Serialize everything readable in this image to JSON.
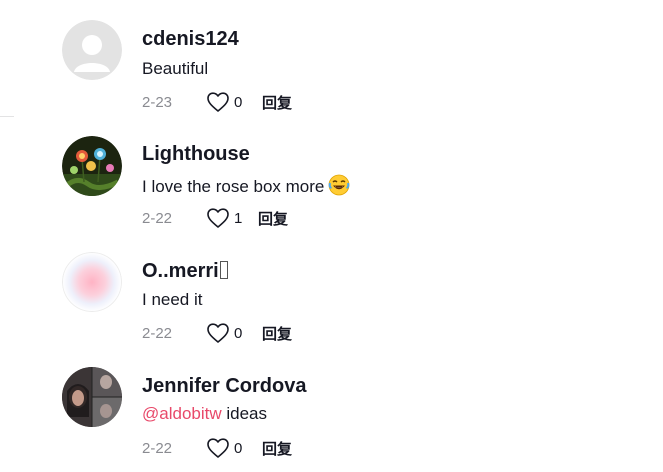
{
  "comments": [
    {
      "username": "cdenis124",
      "text": "Beautiful",
      "date": "2-23",
      "likes": "0",
      "reply_label": "回复",
      "avatar": "default-avatar-icon"
    },
    {
      "username": "Lighthouse",
      "text": "I love the rose box more",
      "emoji": "laughing-tears-emoji",
      "date": "2-22",
      "likes": "1",
      "reply_label": "回复",
      "avatar": "photo-garden-lights"
    },
    {
      "username": "O..merri",
      "text": "I need it",
      "date": "2-22",
      "likes": "0",
      "reply_label": "回复",
      "avatar": "pink-gradient-dot"
    },
    {
      "username": "Jennifer Cordova",
      "mention": "@aldobitw",
      "text": " ideas",
      "date": "2-22",
      "likes": "0",
      "reply_label": "回复",
      "avatar": "photo-collage"
    }
  ],
  "colors": {
    "text": "#161823",
    "muted": "#8a8b91",
    "mention": "#e8496a"
  }
}
